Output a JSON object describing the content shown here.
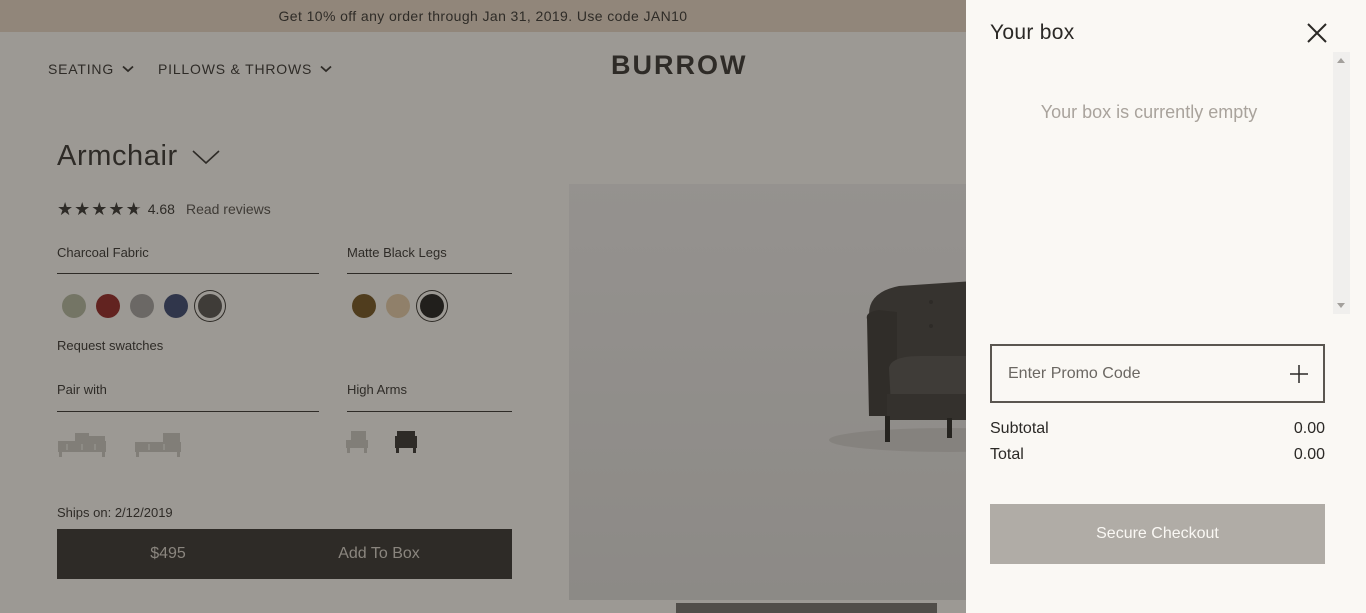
{
  "promo_bar": {
    "text": "Get 10% off any order through Jan 31, 2019. Use code JAN10"
  },
  "nav": {
    "items": [
      {
        "label": "SEATING"
      },
      {
        "label": "PILLOWS & THROWS"
      }
    ],
    "logo": "BURROW"
  },
  "product": {
    "title": "Armchair",
    "rating": "4.68",
    "rating_value": 4.68,
    "rating_max": 5,
    "reviews_link": "Read reviews",
    "fabric": {
      "label": "Charcoal Fabric",
      "swatches": [
        "#aeb39c",
        "#8d1a1a",
        "#9d9c9c",
        "#2f3e6a",
        "#4a4846"
      ],
      "selected": 4
    },
    "legs": {
      "label": "Matte Black Legs",
      "swatches": [
        "#6b4b15",
        "#e2c9a4",
        "#111111"
      ],
      "selected": 2
    },
    "request_swatches": "Request swatches",
    "pair_with": {
      "label": "Pair with"
    },
    "arms": {
      "label": "High Arms"
    },
    "ships_on": "Ships on: 2/12/2019",
    "price": "$495",
    "add_button": "Add To Box"
  },
  "cart": {
    "title": "Your box",
    "empty_message": "Your box is currently empty",
    "promo_placeholder": "Enter Promo Code",
    "subtotal_label": "Subtotal",
    "subtotal_value": "0.00",
    "total_label": "Total",
    "total_value": "0.00",
    "checkout_button": "Secure Checkout"
  },
  "colors": {
    "overlay": "rgba(52,46,40,0.47)",
    "drawer_bg": "#faf8f4",
    "checkout_btn": "#b0aca6",
    "add_btn": "#2b2926",
    "promo_bar": "#e5d4c2"
  }
}
